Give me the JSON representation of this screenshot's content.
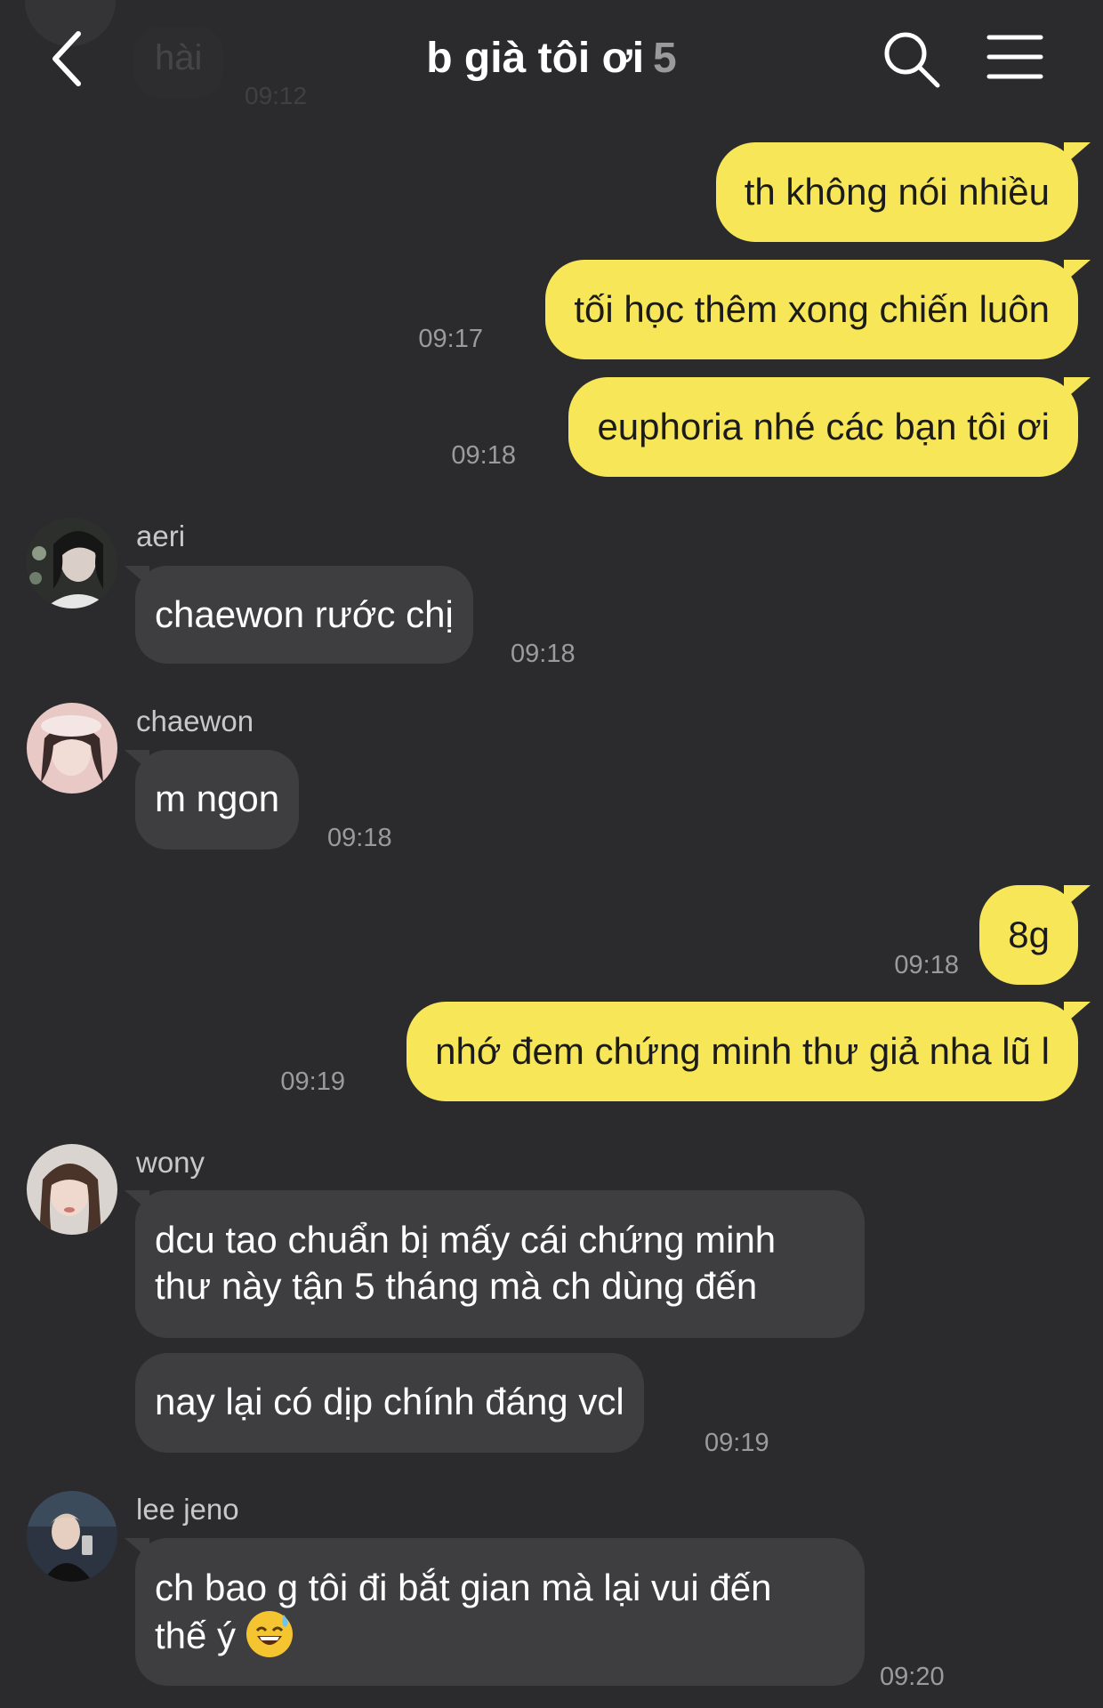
{
  "header": {
    "title": "b già tôi ơi",
    "member_count": "5",
    "prev_message": "hài",
    "prev_time": "09:12"
  },
  "messages": {
    "m1": {
      "text": "th không nói nhiều"
    },
    "m2": {
      "text": "tối học thêm xong chiến luôn",
      "time": "09:17"
    },
    "m3": {
      "text": "euphoria nhé các bạn tôi ơi",
      "time": "09:18"
    },
    "m4": {
      "sender": "aeri",
      "text": "chaewon rước chị",
      "time": "09:18"
    },
    "m5": {
      "sender": "chaewon",
      "text": "m ngon",
      "time": "09:18"
    },
    "m6": {
      "text": "8g",
      "time": "09:18"
    },
    "m7": {
      "text": "nhớ đem chứng minh thư giả nha lũ l",
      "time": "09:19"
    },
    "m8": {
      "sender": "wony",
      "line1": "dcu tao chuẩn bị mấy cái chứng minh",
      "line2": "thư này tận 5 tháng mà ch dùng đến"
    },
    "m9": {
      "text": "nay lại có dịp chính đáng vcl",
      "time": "09:19"
    },
    "m10": {
      "sender": "lee jeno",
      "line1": "ch bao g tôi đi bắt gian mà lại vui đến",
      "line2": "thế ý",
      "time": "09:20"
    }
  },
  "icons": {
    "back": "chevron-left-icon",
    "search": "search-icon",
    "menu": "hamburger-menu-icon",
    "emoji": "sweat-smile-emoji"
  },
  "colors": {
    "background": "#2b2b2d",
    "outgoing_bubble": "#f7e758",
    "incoming_bubble": "#3e3e40",
    "timestamp": "#9b9b9d"
  }
}
